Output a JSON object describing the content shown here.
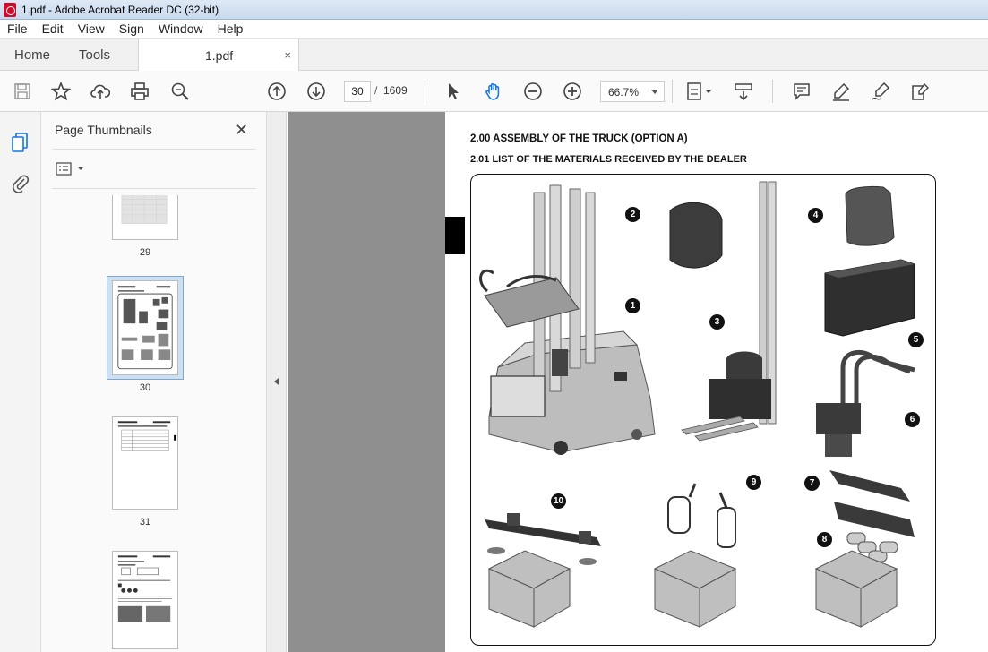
{
  "window": {
    "title": "1.pdf - Adobe Acrobat Reader DC (32-bit)"
  },
  "menu": [
    "File",
    "Edit",
    "View",
    "Sign",
    "Window",
    "Help"
  ],
  "tabs": {
    "home": "Home",
    "tools": "Tools",
    "document": "1.pdf",
    "close": "×"
  },
  "toolbar": {
    "current_page": "30",
    "page_separator": "/",
    "total_pages": "1609",
    "zoom": "66.7%"
  },
  "thumbnail_panel": {
    "title": "Page Thumbnails",
    "close": "✕",
    "pages": [
      {
        "label": "29"
      },
      {
        "label": "30",
        "selected": true
      },
      {
        "label": "31"
      },
      {
        "label": ""
      }
    ]
  },
  "document": {
    "heading_1": "2.00  ASSEMBLY OF THE TRUCK  (OPTION A)",
    "heading_2": "2.01   LIST OF THE MATERIALS RECEIVED BY THE DEALER",
    "callouts": [
      "1",
      "2",
      "3",
      "4",
      "5",
      "6",
      "7",
      "8",
      "9",
      "10"
    ]
  },
  "icons": {
    "save": "save-icon",
    "star": "bookmark-star-icon",
    "upload": "cloud-upload-icon",
    "print": "print-icon",
    "search": "zoom-search-icon",
    "prev": "previous-page-icon",
    "next": "next-page-icon",
    "select": "select-cursor-icon",
    "hand": "hand-pan-icon",
    "zoom_out": "zoom-out-icon",
    "zoom_in": "zoom-in-icon"
  }
}
